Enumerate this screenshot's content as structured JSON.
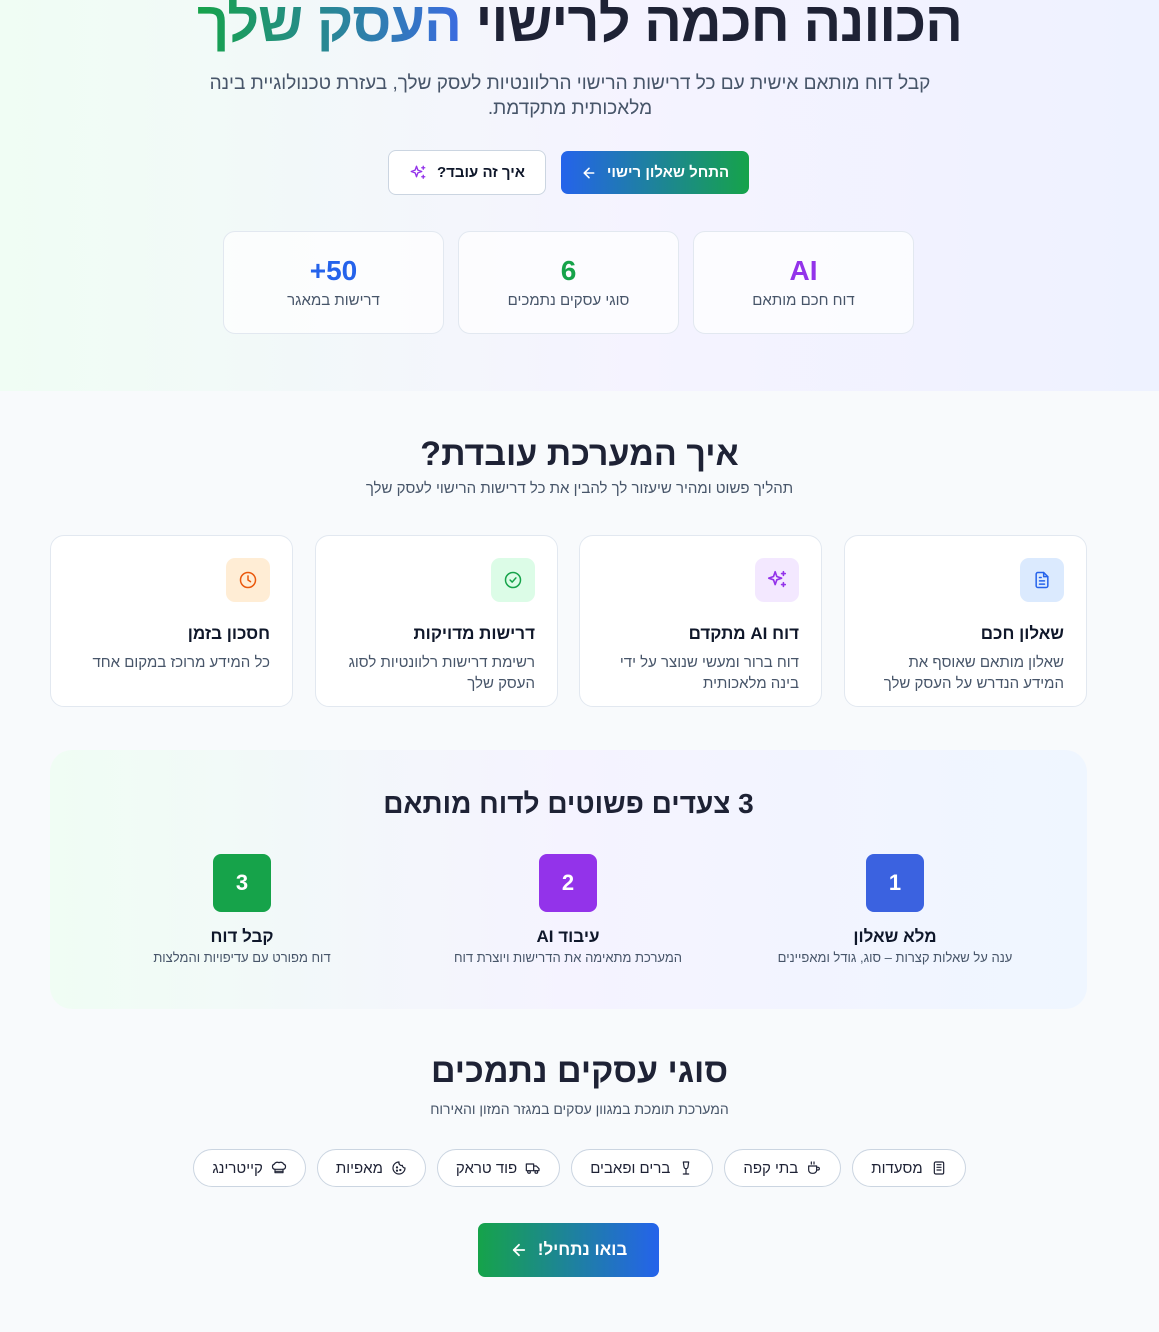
{
  "hero": {
    "title_main": "הכוונה חכמה לרישוי",
    "title_accent": "העסק שלך",
    "subtitle": "קבל דוח מותאם אישית עם כל דרישות הרישוי הרלוונטיות לעסק שלך, בעזרת טכנולוגיית בינה מלאכותית מתקדמת.",
    "primary_button": "התחל שאלון רישוי",
    "secondary_button": "איך זה עובד?"
  },
  "stats": [
    {
      "value": "AI",
      "label": "דוח חכם מותאם",
      "color": "#9333ea"
    },
    {
      "value": "6",
      "label": "סוגי עסקים נתמכים",
      "color": "#16a34a"
    },
    {
      "value": "50+",
      "label": "דרישות במאגר",
      "color": "#2563eb"
    }
  ],
  "how": {
    "title": "איך המערכת עובדת?",
    "subtitle": "תהליך פשוט ומהיר שיעזור לך להבין את כל דרישות הרישוי לעסק שלך",
    "features": [
      {
        "icon": "document-icon",
        "title": "שאלון חכם",
        "desc": "שאלון מותאם שאוסף את המידע הנדרש על העסק שלך",
        "color": "#2563eb",
        "bg": "#dbeafe"
      },
      {
        "icon": "sparkles-icon",
        "title": "דוח AI מתקדם",
        "desc": "דוח ברור ומעשי שנוצר על ידי בינה מלאכותית",
        "color": "#9333ea",
        "bg": "#f3e8ff"
      },
      {
        "icon": "check-circle-icon",
        "title": "דרישות מדויקות",
        "desc": "רשימת דרישות רלוונטיות לסוג העסק שלך",
        "color": "#16a34a",
        "bg": "#dcfce7"
      },
      {
        "icon": "clock-icon",
        "title": "חסכון בזמן",
        "desc": "כל המידע מרוכז במקום אחד",
        "color": "#ea580c",
        "bg": "#ffedd5"
      }
    ]
  },
  "steps": {
    "title": "3 צעדים פשוטים לדוח מותאם",
    "items": [
      {
        "num": "1",
        "title": "מלא שאלון",
        "desc": "ענה על שאלות קצרות – סוג, גודל ומאפיינים",
        "color": "#2563eb"
      },
      {
        "num": "2",
        "title": "עיבוד AI",
        "desc": "המערכת מתאימה את הדרישות ויוצרת דוח",
        "color": "#9333ea"
      },
      {
        "num": "3",
        "title": "קבל דוח",
        "desc": "דוח מפורט עם עדיפויות והמלצות",
        "color": "#16a34a"
      }
    ]
  },
  "business": {
    "title": "סוגי עסקים נתמכים",
    "subtitle": "המערכת תומכת במגוון עסקים במגזר המזון והאירוח",
    "types": [
      {
        "label": "מסעדות",
        "icon": "restaurant-icon"
      },
      {
        "label": "בתי קפה",
        "icon": "coffee-icon"
      },
      {
        "label": "ברים ופאבים",
        "icon": "wine-glass-icon"
      },
      {
        "label": "פוד טראק",
        "icon": "truck-icon"
      },
      {
        "label": "מאפיות",
        "icon": "cookie-icon"
      },
      {
        "label": "קייטרינג",
        "icon": "chef-hat-icon"
      }
    ],
    "cta": "בואו נתחיל!"
  }
}
